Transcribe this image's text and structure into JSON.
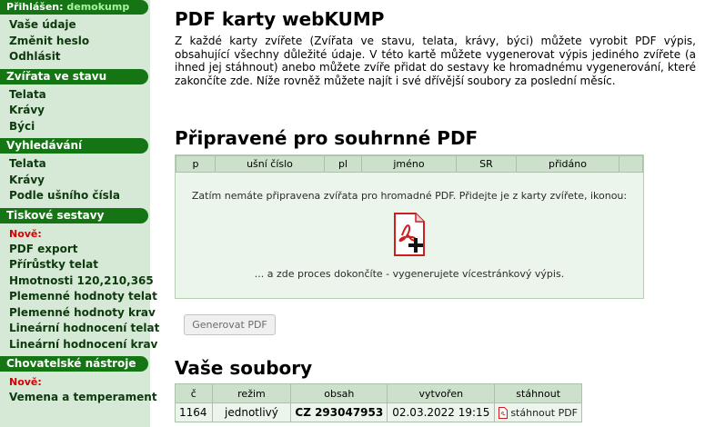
{
  "login": {
    "label": "Přihlášen:",
    "user": "demokump"
  },
  "sidebar": {
    "account": [
      {
        "label": "Vaše údaje"
      },
      {
        "label": "Změnit heslo"
      },
      {
        "label": "Odhlásit"
      }
    ],
    "animals": {
      "title": "Zvířata ve stavu",
      "items": [
        {
          "label": "Telata"
        },
        {
          "label": "Krávy"
        },
        {
          "label": "Býci"
        }
      ]
    },
    "search": {
      "title": "Vyhledávání",
      "items": [
        {
          "label": "Telata"
        },
        {
          "label": "Krávy"
        },
        {
          "label": "Podle ušního čísla"
        }
      ]
    },
    "reports": {
      "title": "Tiskové sestavy",
      "new_label": "Nově:",
      "items": [
        {
          "label": "PDF export"
        },
        {
          "label": "Přírůstky telat"
        },
        {
          "label": "Hmotnosti 120,210,365"
        },
        {
          "label": "Plemenné hodnoty telat"
        },
        {
          "label": "Plemenné hodnoty krav"
        },
        {
          "label": "Lineární hodnocení telat"
        },
        {
          "label": "Lineární hodnocení krav"
        }
      ]
    },
    "tools": {
      "title": "Chovatelské nástroje",
      "new_label": "Nově:",
      "items": [
        {
          "label": "Vemena a temperament"
        }
      ]
    }
  },
  "main": {
    "title": "PDF karty webKUMP",
    "intro": "Z každé karty zvířete (Zvířata ve stavu, telata, krávy, býci) můžete vyrobit PDF výpis, obsahující všechny důležité údaje. V této kartě můžete vygenerovat výpis jediného zvířete (a ihned jej stáhnout) anebo můžete zvíře přidat do sestavy ke hromadnému vygenerování, které zakončíte zde. Níže rovněž můžete najít i své dřívější soubory za poslední měsíc.",
    "prepared": {
      "title": "Připravené pro souhrnné PDF",
      "columns": [
        "p",
        "ušní číslo",
        "pl",
        "jméno",
        "SR",
        "přidáno",
        ""
      ],
      "empty_text": "Zatím nemáte připravena zvířata pro hromadné PDF. Přidejte je z karty zvířete, ikonou:",
      "finish_text": "... a zde proces dokončíte - vygenerujete vícestránkový výpis."
    },
    "generate_button": "Generovat PDF",
    "files": {
      "title": "Vaše soubory",
      "columns": [
        "č",
        "režim",
        "obsah",
        "vytvořen",
        "stáhnout"
      ],
      "rows": [
        {
          "id": "1164",
          "mode": "jednotlivý",
          "content": "CZ 293047953",
          "created": "02.03.2022 19:15",
          "download": "stáhnout PDF"
        }
      ]
    }
  },
  "colors": {
    "sidebar_bg": "#d6e8d6",
    "section_header": "#157515",
    "table_header": "#cce0cc",
    "box_bg": "#ebf5eb",
    "new_badge": "#d80000",
    "pdf_red": "#cc1f1f"
  }
}
